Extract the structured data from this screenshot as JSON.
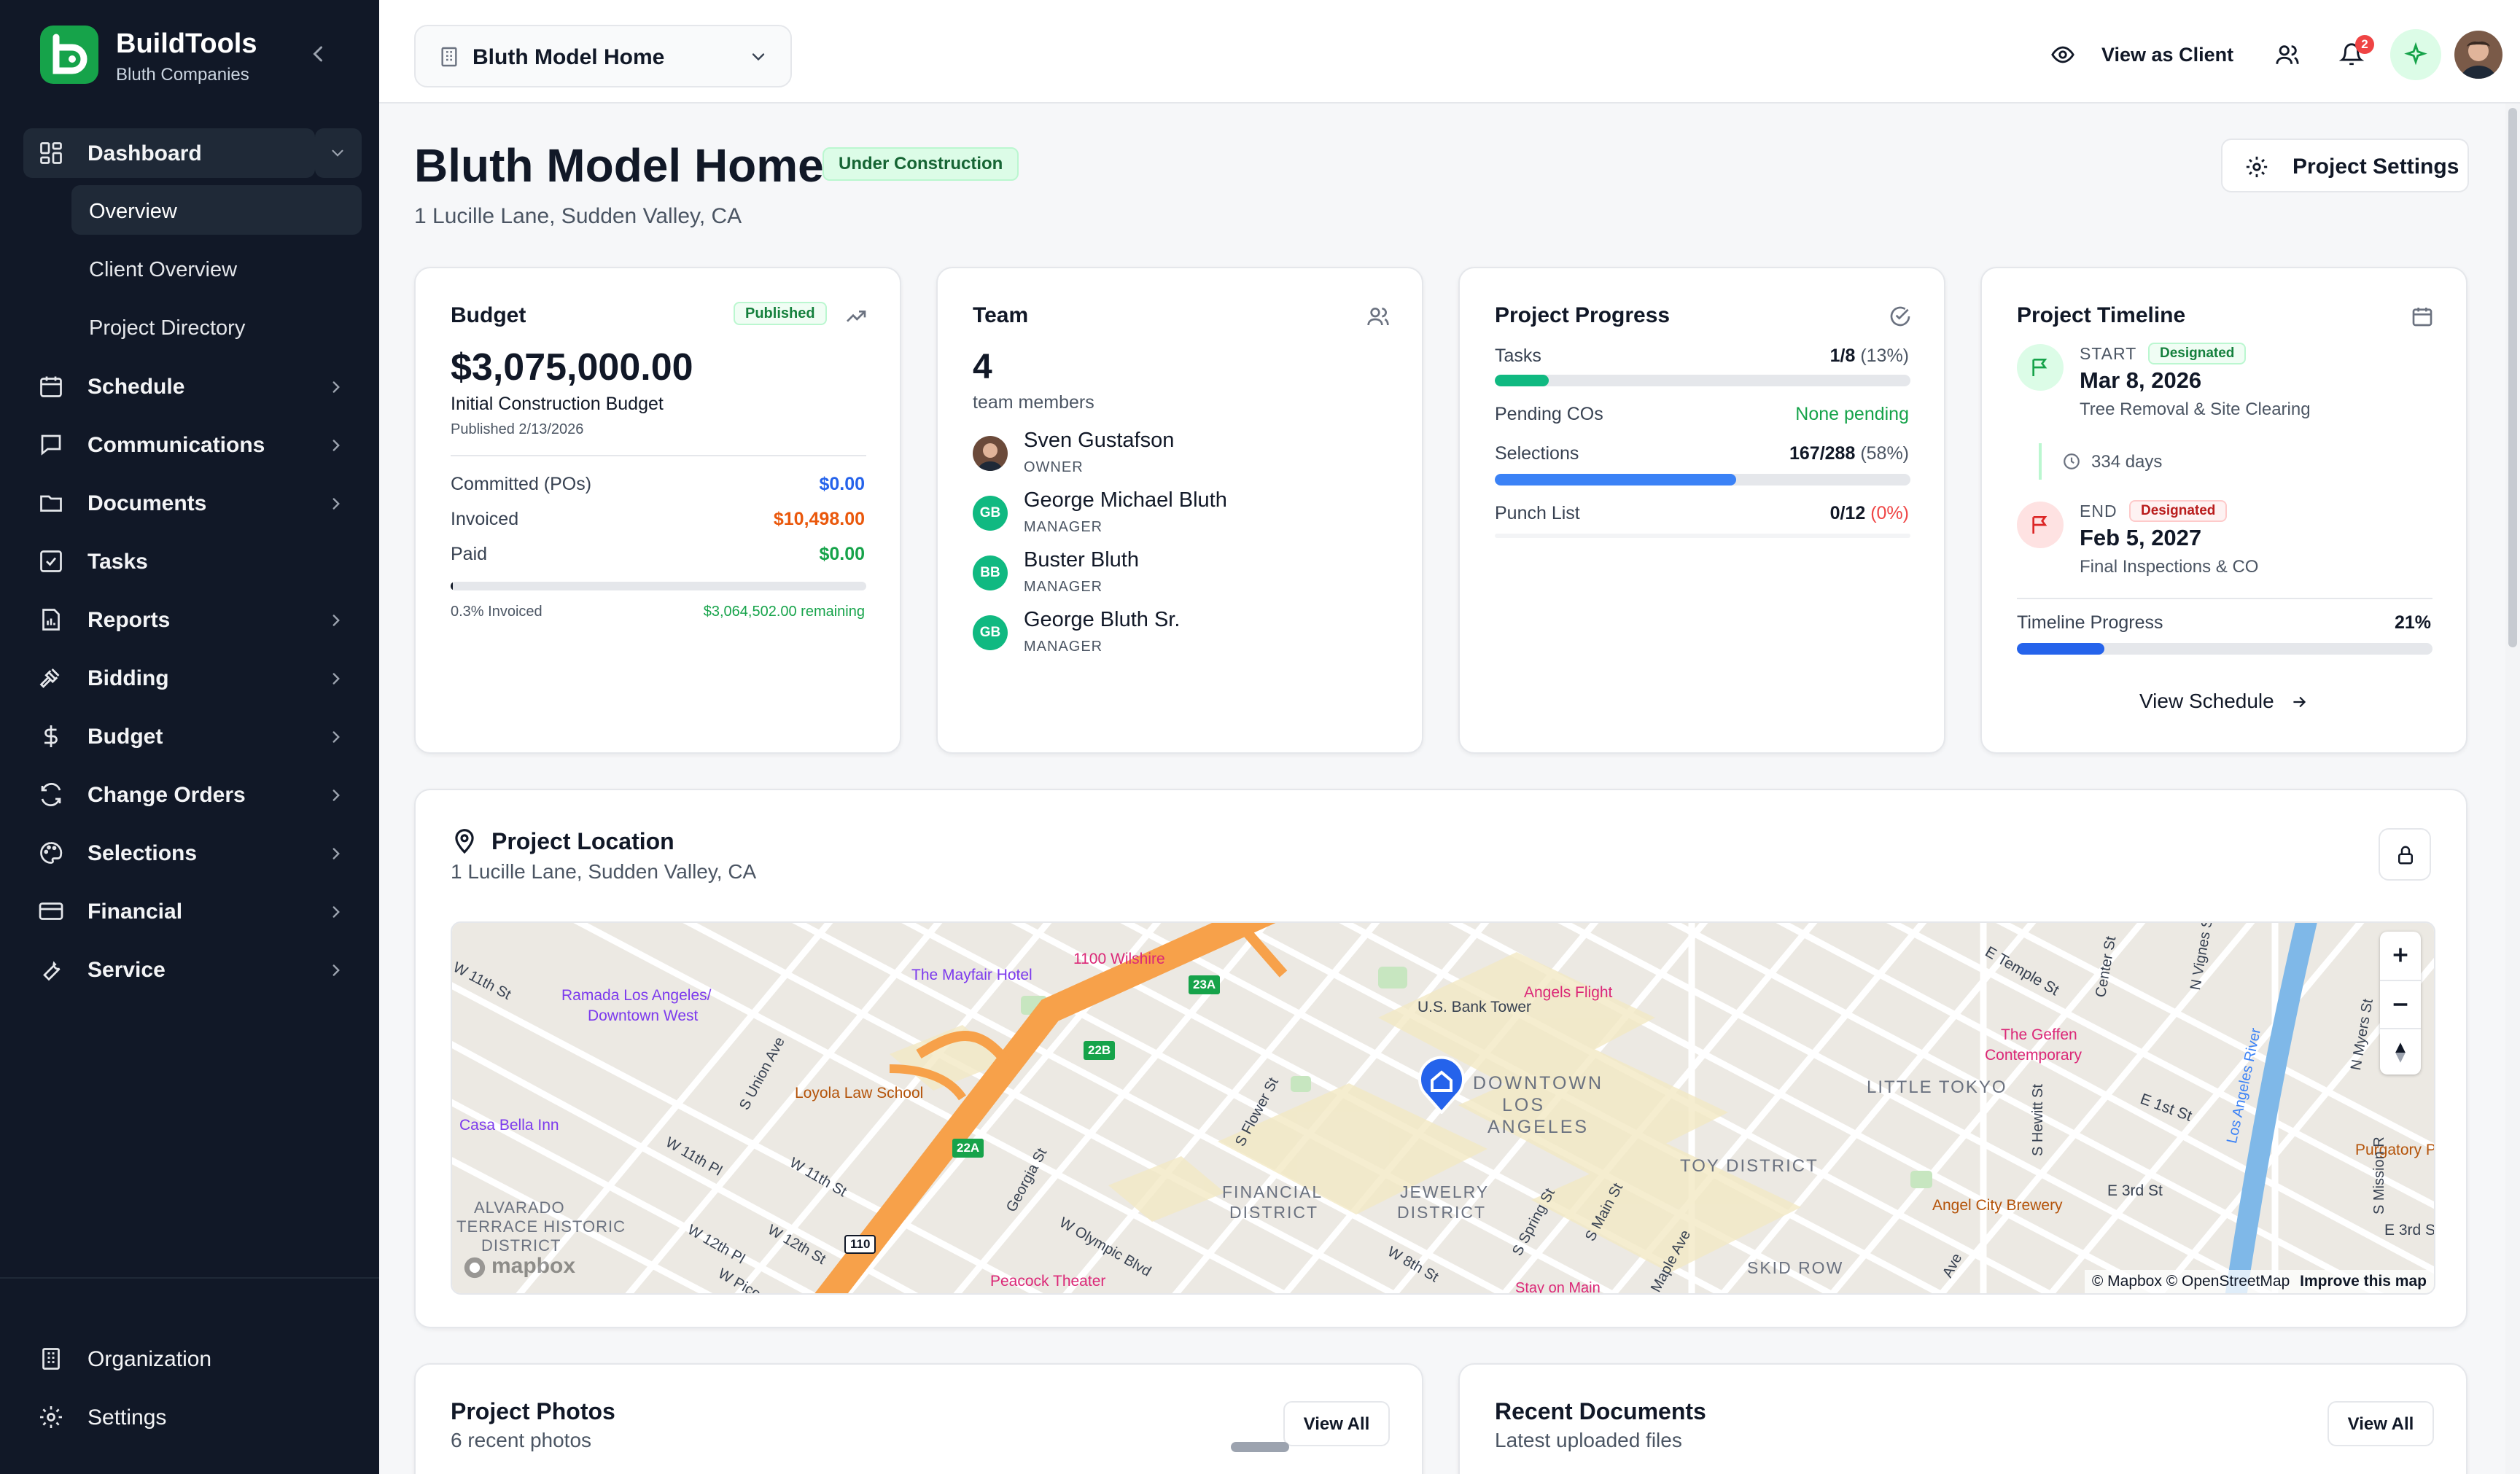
{
  "brand": {
    "name": "BuildTools",
    "subtitle": "Bluth Companies"
  },
  "sidebar": {
    "items": [
      {
        "label": "Dashboard",
        "icon": "dashboard-icon"
      },
      {
        "label": "Schedule",
        "icon": "calendar-icon"
      },
      {
        "label": "Communications",
        "icon": "chat-icon"
      },
      {
        "label": "Documents",
        "icon": "folder-icon"
      },
      {
        "label": "Tasks",
        "icon": "checkbox-icon"
      },
      {
        "label": "Reports",
        "icon": "report-icon"
      },
      {
        "label": "Bidding",
        "icon": "gavel-icon"
      },
      {
        "label": "Budget",
        "icon": "dollar-icon"
      },
      {
        "label": "Change Orders",
        "icon": "refresh-icon"
      },
      {
        "label": "Selections",
        "icon": "palette-icon"
      },
      {
        "label": "Financial",
        "icon": "card-icon"
      },
      {
        "label": "Service",
        "icon": "wrench-icon"
      }
    ],
    "dashboard_sub": [
      "Overview",
      "Client Overview",
      "Project Directory"
    ],
    "bottom": [
      {
        "label": "Organization",
        "icon": "building-icon"
      },
      {
        "label": "Settings",
        "icon": "gear-icon"
      }
    ]
  },
  "topbar": {
    "project": "Bluth Model Home",
    "view_as_client": "View as Client",
    "notification_count": "2"
  },
  "project": {
    "title": "Bluth Model Home",
    "status": "Under Construction",
    "address": "1 Lucille Lane, Sudden Valley, CA",
    "settings_label": "Project Settings"
  },
  "budget": {
    "title": "Budget",
    "badge": "Published",
    "amount": "$3,075,000.00",
    "subtitle": "Initial Construction Budget",
    "published": "Published 2/13/2026",
    "rows": [
      {
        "label": "Committed (POs)",
        "value": "$0.00",
        "color": "#2563eb"
      },
      {
        "label": "Invoiced",
        "value": "$10,498.00",
        "color": "#ea580c"
      },
      {
        "label": "Paid",
        "value": "$0.00",
        "color": "#16a34a"
      }
    ],
    "invoiced_pct_label": "0.3% Invoiced",
    "remaining": "$3,064,502.00 remaining",
    "progress": 0.003
  },
  "team": {
    "title": "Team",
    "count": "4",
    "count_label": "team members",
    "members": [
      {
        "name": "Sven Gustafson",
        "role": "OWNER",
        "initials": ""
      },
      {
        "name": "George Michael Bluth",
        "role": "MANAGER",
        "initials": "GB"
      },
      {
        "name": "Buster Bluth",
        "role": "MANAGER",
        "initials": "BB"
      },
      {
        "name": "George Bluth Sr.",
        "role": "MANAGER",
        "initials": "GB"
      }
    ]
  },
  "progress": {
    "title": "Project Progress",
    "tasks": {
      "label": "Tasks",
      "value": "1/8",
      "pct": "(13%)",
      "fraction": 0.13
    },
    "pending": {
      "label": "Pending COs",
      "value": "None pending"
    },
    "selections": {
      "label": "Selections",
      "value": "167/288",
      "pct": "(58%)",
      "fraction": 0.58
    },
    "punch": {
      "label": "Punch List",
      "value": "0/12",
      "pct": "(0%)",
      "fraction": 0
    }
  },
  "timeline": {
    "title": "Project Timeline",
    "start": {
      "label": "START",
      "badge": "Designated",
      "date": "Mar 8, 2026",
      "task": "Tree Removal & Site Clearing"
    },
    "duration": "334 days",
    "end": {
      "label": "END",
      "badge": "Designated",
      "date": "Feb 5, 2027",
      "task": "Final Inspections & CO"
    },
    "progress_label": "Timeline Progress",
    "progress_pct": "21%",
    "progress": 0.21,
    "view_schedule": "View Schedule"
  },
  "location": {
    "title": "Project Location",
    "address": "1 Lucille Lane, Sudden Valley, CA",
    "map": {
      "labels": [
        {
          "text": "W 11th St",
          "color": "#374151"
        },
        {
          "text": "Ramada Los Angeles/",
          "color": "#7c3aed"
        },
        {
          "text": "Downtown West",
          "color": "#7c3aed"
        },
        {
          "text": "The Mayfair Hotel",
          "color": "#7c3aed"
        },
        {
          "text": "1100 Wilshire",
          "color": "#db2777"
        },
        {
          "text": "S Union Ave",
          "color": "#374151"
        },
        {
          "text": "Loyola Law School",
          "color": "#b45309"
        },
        {
          "text": "Casa Bella Inn",
          "color": "#7c3aed"
        },
        {
          "text": "W 11th Pl",
          "color": "#374151"
        },
        {
          "text": "W 11th St",
          "color": "#374151"
        },
        {
          "text": "ALVARADO",
          "color": "#6b7280"
        },
        {
          "text": "TERRACE HISTORIC",
          "color": "#6b7280"
        },
        {
          "text": "DISTRICT",
          "color": "#6b7280"
        },
        {
          "text": "W 12th Pl",
          "color": "#374151"
        },
        {
          "text": "W 12th St",
          "color": "#374151"
        },
        {
          "text": "W Pico",
          "color": "#374151"
        },
        {
          "text": "Georgia St",
          "color": "#374151"
        },
        {
          "text": "Peacock Theater",
          "color": "#db2777"
        },
        {
          "text": "W Olympic Blvd",
          "color": "#374151"
        },
        {
          "text": "U.S. Bank Tower",
          "color": "#374151"
        },
        {
          "text": "Angels Flight",
          "color": "#db2777"
        },
        {
          "text": "S Flower St",
          "color": "#374151"
        },
        {
          "text": "DOWNTOWN",
          "color": "#6b7280"
        },
        {
          "text": "LOS",
          "color": "#6b7280"
        },
        {
          "text": "ANGELES",
          "color": "#6b7280"
        },
        {
          "text": "FINANCIAL",
          "color": "#6b7280"
        },
        {
          "text": "DISTRICT",
          "color": "#6b7280"
        },
        {
          "text": "JEWELRY",
          "color": "#6b7280"
        },
        {
          "text": "DISTRICT",
          "color": "#6b7280"
        },
        {
          "text": "W 8th St",
          "color": "#374151"
        },
        {
          "text": "S Spring St",
          "color": "#374151"
        },
        {
          "text": "S Main St",
          "color": "#374151"
        },
        {
          "text": "Maple Ave",
          "color": "#374151"
        },
        {
          "text": "Stay on Main",
          "color": "#db2777"
        },
        {
          "text": "E Temple St",
          "color": "#374151"
        },
        {
          "text": "The Geffen",
          "color": "#db2777"
        },
        {
          "text": "Contemporary",
          "color": "#db2777"
        },
        {
          "text": "LITTLE TOKYO",
          "color": "#6b7280"
        },
        {
          "text": "TOY DISTRICT",
          "color": "#6b7280"
        },
        {
          "text": "SKID ROW",
          "color": "#6b7280"
        },
        {
          "text": "Angel City Brewery",
          "color": "#b45309"
        },
        {
          "text": "E 1st St",
          "color": "#374151"
        },
        {
          "text": "E 3rd St",
          "color": "#374151"
        },
        {
          "text": "E 3rd S",
          "color": "#374151"
        },
        {
          "text": "Purgatory P",
          "color": "#b45309"
        },
        {
          "text": "N Vignes St",
          "color": "#374151"
        },
        {
          "text": "Center St",
          "color": "#374151"
        },
        {
          "text": "N Myers St",
          "color": "#374151"
        },
        {
          "text": "S Hewitt St",
          "color": "#374151"
        },
        {
          "text": "Los Angeles River",
          "color": "#3b82f6"
        },
        {
          "text": "S Mission R",
          "color": "#374151"
        },
        {
          "text": "Ave",
          "color": "#374151"
        }
      ],
      "shields": [
        "23A",
        "22B",
        "22A",
        "110"
      ],
      "attribution": "© Mapbox © OpenStreetMap",
      "improve": "Improve this map",
      "logo": "mapbox"
    }
  },
  "photos": {
    "title": "Project Photos",
    "subtitle": "6 recent photos",
    "view_all": "View All"
  },
  "documents": {
    "title": "Recent Documents",
    "subtitle": "Latest uploaded files",
    "view_all": "View All"
  }
}
